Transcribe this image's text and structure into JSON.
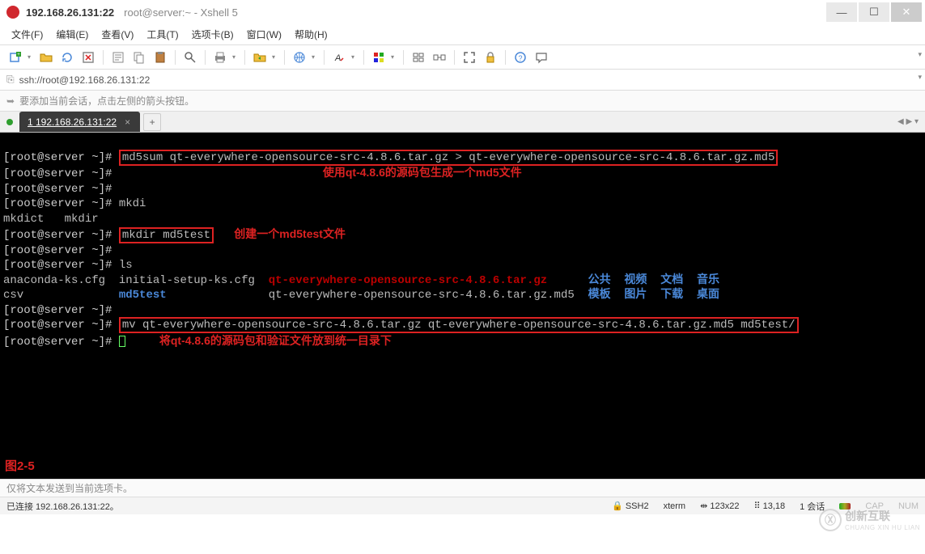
{
  "window": {
    "title_host": "192.168.26.131:22",
    "title_app": "root@server:~ - Xshell 5",
    "min": "—",
    "max": "☐",
    "close": "✕"
  },
  "menu": {
    "file": "文件(F)",
    "edit": "编辑(E)",
    "view": "查看(V)",
    "tools": "工具(T)",
    "tabs": "选项卡(B)",
    "window": "窗口(W)",
    "help": "帮助(H)"
  },
  "address": {
    "icon": "⎘",
    "url": "ssh://root@192.168.26.131:22"
  },
  "hint": {
    "arrow": "➥",
    "text": "要添加当前会话，点击左侧的箭头按钮。"
  },
  "tab": {
    "label": "1 192.168.26.131:22",
    "close": "×",
    "add": "+",
    "nav": "◀  ▶  ▾"
  },
  "terminal": {
    "prompt": "[root@server ~]# ",
    "cmd1": "md5sum qt-everywhere-opensource-src-4.8.6.tar.gz > qt-everywhere-opensource-src-4.8.6.tar.gz.md5",
    "annot1": "使用qt-4.8.6的源码包生成一个md5文件",
    "cmd_mkdi": "mkdi",
    "mkdi_out": "mkdict   mkdir",
    "cmd2": "mkdir md5test",
    "annot2": "创建一个md5test文件",
    "cmd_ls": "ls",
    "ls_c1a": "anaconda-ks.cfg",
    "ls_c1b": "csv",
    "ls_c2a": "initial-setup-ks.cfg",
    "ls_c2b": "md5test",
    "ls_c3a": "qt-everywhere-opensource-src-4.8.6.tar.gz",
    "ls_c3b": "qt-everywhere-opensource-src-4.8.6.tar.gz.md5",
    "ls_d1": "公共",
    "ls_d2": "视频",
    "ls_d3": "文档",
    "ls_d4": "音乐",
    "ls_d5": "模板",
    "ls_d6": "图片",
    "ls_d7": "下载",
    "ls_d8": "桌面",
    "cmd3": "mv qt-everywhere-opensource-src-4.8.6.tar.gz qt-everywhere-opensource-src-4.8.6.tar.gz.md5 md5test/",
    "annot3": "将qt-4.8.6的源码包和验证文件放到统一目录下",
    "fig": "图2-5"
  },
  "hint2": "仅将文本发送到当前选项卡。",
  "status": {
    "conn": "已连接 192.168.26.131:22。",
    "ssh": "SSH2",
    "term": "xterm",
    "size_icon": "⇹",
    "size": "123x22",
    "pos_icon": "⠿",
    "pos": "13,18",
    "sess": "1 会话",
    "sess_icon": "�powershelled",
    "caps": "CAP",
    "num": "NUM"
  },
  "watermark": {
    "big": "创新互联",
    "small": "CHUANG XIN HU LIAN"
  }
}
